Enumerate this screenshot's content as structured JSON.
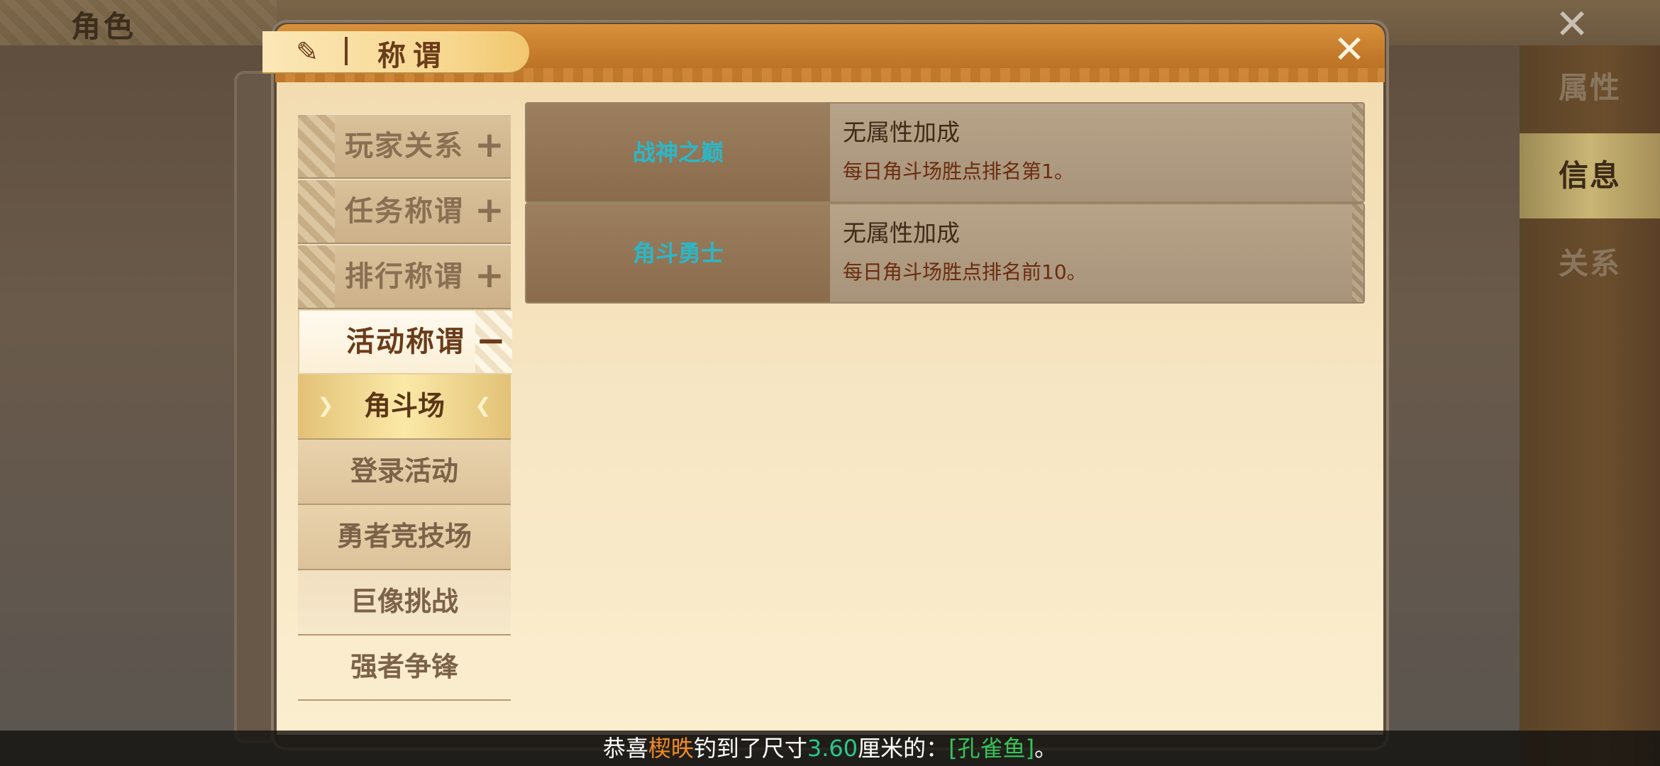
{
  "background": {
    "title": "角色",
    "right_tabs": [
      {
        "label": "属性",
        "active": false
      },
      {
        "label": "信息",
        "active": true
      },
      {
        "label": "关系",
        "active": false
      }
    ]
  },
  "dialog": {
    "title": "称谓",
    "close_icon": "close-x"
  },
  "categories": [
    {
      "label": "玩家关系",
      "expanded": false
    },
    {
      "label": "任务称谓",
      "expanded": false
    },
    {
      "label": "排行称谓",
      "expanded": false
    },
    {
      "label": "活动称谓",
      "expanded": true
    }
  ],
  "subcategories": [
    {
      "label": "角斗场",
      "selected": true
    },
    {
      "label": "登录活动",
      "selected": false
    },
    {
      "label": "勇者竞技场",
      "selected": false
    },
    {
      "label": "巨像挑战",
      "selected": false
    },
    {
      "label": "强者争锋",
      "selected": false
    }
  ],
  "titles": [
    {
      "name": "战神之巅",
      "attribute": "无属性加成",
      "description": "每日角斗场胜点排名第1。"
    },
    {
      "name": "角斗勇士",
      "attribute": "无属性加成",
      "description": "每日角斗场胜点排名前10。"
    }
  ],
  "broadcast": {
    "prefix": "恭喜",
    "player": "楔昳",
    "middle": "钓到了尺寸",
    "size": "3.60",
    "unit": "厘米的：",
    "item": "[孔雀鱼]",
    "suffix": "。",
    "colors": {
      "player": "#f08a24",
      "size": "#29c78a",
      "item": "#36c35a"
    }
  }
}
